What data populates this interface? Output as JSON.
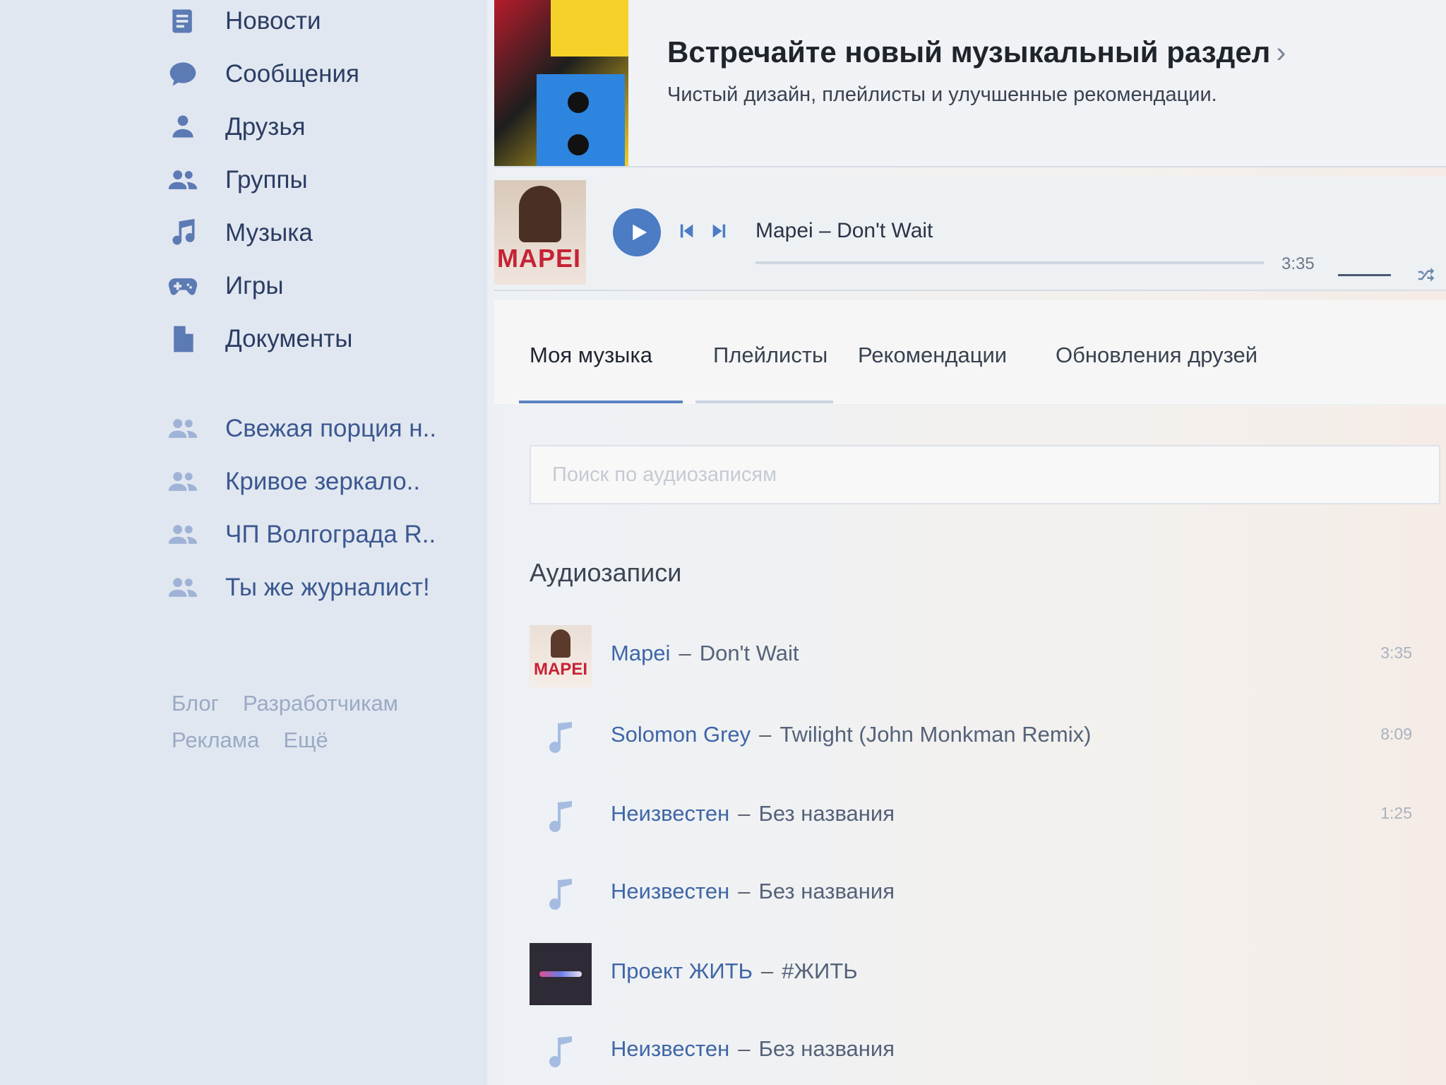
{
  "sidebar": {
    "nav": [
      {
        "label": "Новости",
        "icon": "news-icon"
      },
      {
        "label": "Сообщения",
        "icon": "messages-icon"
      },
      {
        "label": "Друзья",
        "icon": "friends-icon"
      },
      {
        "label": "Группы",
        "icon": "groups-icon"
      },
      {
        "label": "Музыка",
        "icon": "music-icon"
      },
      {
        "label": "Игры",
        "icon": "games-icon"
      },
      {
        "label": "Документы",
        "icon": "documents-icon"
      }
    ],
    "groups": [
      {
        "label": "Свежая порция н.."
      },
      {
        "label": "Кривое зеркало.."
      },
      {
        "label": "ЧП Волгограда R.."
      },
      {
        "label": "Ты же журналист!"
      }
    ],
    "footer": [
      "Блог",
      "Разработчикам",
      "Реклама",
      "Ещё"
    ]
  },
  "promo": {
    "title": "Встречайте новый музыкальный раздел",
    "chevron": "›",
    "subtitle": "Чистый дизайн, плейлисты и улучшенные рекомендации."
  },
  "player": {
    "cover_text": "MAPEI",
    "track": "Mapei – Don't Wait",
    "duration": "3:35",
    "progress": 0.0
  },
  "tabs": [
    "Моя музыка",
    "Плейлисты",
    "Рекомендации",
    "Обновления друзей"
  ],
  "search": {
    "placeholder": "Поиск по аудиозаписям"
  },
  "audio": {
    "title": "Аудиозаписи",
    "tracks": [
      {
        "artist": "Mapei",
        "title": "Don't Wait",
        "duration": "3:35",
        "cover": "mapei"
      },
      {
        "artist": "Solomon Grey",
        "title": "Twilight (John Monkman Remix)",
        "duration": "8:09",
        "cover": "note"
      },
      {
        "artist": "Неизвестен",
        "title": "Без названия",
        "duration": "1:25",
        "cover": "note"
      },
      {
        "artist": "Неизвестен",
        "title": "Без названия",
        "duration": "",
        "cover": "note"
      },
      {
        "artist": "Проект ЖИТЬ",
        "title": "#ЖИТЬ",
        "duration": "",
        "cover": "project"
      },
      {
        "artist": "Неизвестен",
        "title": "Без названия",
        "duration": "",
        "cover": "note"
      }
    ]
  },
  "colors": {
    "accent": "#4b7cc4",
    "link": "#3f66a6",
    "sidebar_bg": "#e1e7f0"
  }
}
